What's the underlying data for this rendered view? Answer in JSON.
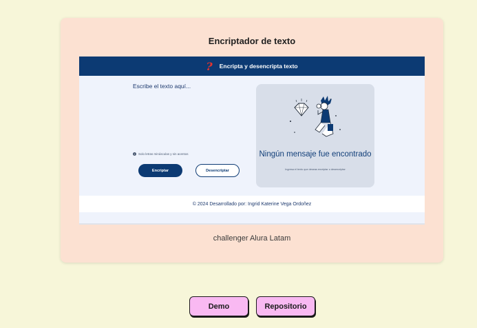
{
  "project": {
    "title": "Encriptador de texto",
    "caption": "challenger Alura Latam"
  },
  "preview": {
    "logo": "?",
    "header_title": "Encripta y desencripta texto",
    "textarea_placeholder": "Escribe el texto aquí...",
    "notice": "Solo letras minúsculas y sin acentos",
    "notice_icon": "i",
    "encrypt_label": "Encriptar",
    "decrypt_label": "Desencriptar",
    "empty_title": "Ningún mensaje fue encontrado",
    "empty_subtitle": "Ingresa el texto que deseas encriptar o desencriptar",
    "footer": "© 2024 Desarrollado por: Ingrid Katerine Vega Ordoñez"
  },
  "actions": {
    "demo_label": "Demo",
    "repo_label": "Repositorio"
  },
  "colors": {
    "page_bg": "#f7f6d9",
    "card_bg": "#fce1d2",
    "header_navy": "#0c3a73",
    "button_pink": "#f9b9f2"
  }
}
